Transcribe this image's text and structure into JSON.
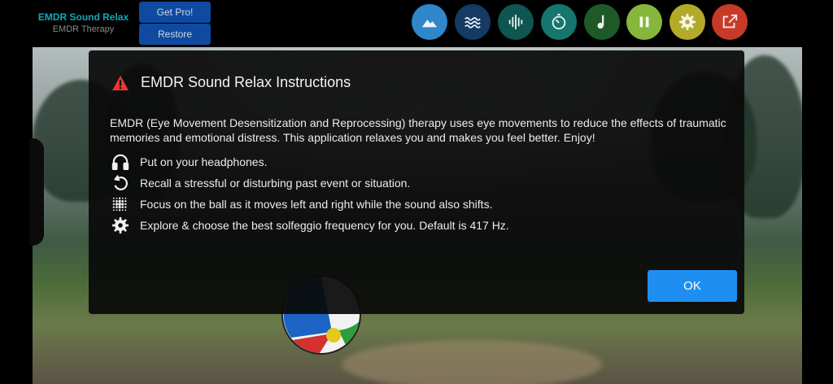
{
  "app": {
    "title": "EMDR Sound Relax",
    "subtitle": "EMDR Therapy"
  },
  "header": {
    "get_pro_label": "Get Pro!",
    "restore_label": "Restore"
  },
  "toolbar": {
    "buttons": [
      {
        "name": "scene-button",
        "icon": "mountain-icon",
        "color": "#2f86c8"
      },
      {
        "name": "waves-button",
        "icon": "waves-icon",
        "color": "#153a63"
      },
      {
        "name": "sound-button",
        "icon": "waveform-icon",
        "color": "#0f5552"
      },
      {
        "name": "timer-button",
        "icon": "timer-icon",
        "color": "#16756c"
      },
      {
        "name": "music-button",
        "icon": "music-note-icon",
        "color": "#1e5a27"
      },
      {
        "name": "pause-button",
        "icon": "pause-icon",
        "color": "#86b63c"
      },
      {
        "name": "settings-button",
        "icon": "gear-icon",
        "color": "#b4aa29"
      },
      {
        "name": "share-button",
        "icon": "external-link-icon",
        "color": "#c73a27"
      }
    ]
  },
  "dialog": {
    "title": "EMDR Sound Relax Instructions",
    "description": "EMDR (Eye Movement Desensitization and Reprocessing) therapy uses eye movements to reduce the effects of traumatic memories and emotional distress. This application relaxes you and makes you feel better. Enjoy!",
    "steps": [
      {
        "icon": "headphones-icon",
        "text": "Put on your headphones."
      },
      {
        "icon": "replay-icon",
        "text": "Recall a stressful or disturbing past event or situation."
      },
      {
        "icon": "dots-grid-icon",
        "text": "Focus on the ball as it moves left and right while the sound also shifts."
      },
      {
        "icon": "gear-icon",
        "text": "Explore & choose the best solfeggio frequency for you. Default is 417 Hz."
      }
    ],
    "ok_label": "OK",
    "accent_color": "#1e8ff0",
    "warning_color": "#e53935"
  }
}
